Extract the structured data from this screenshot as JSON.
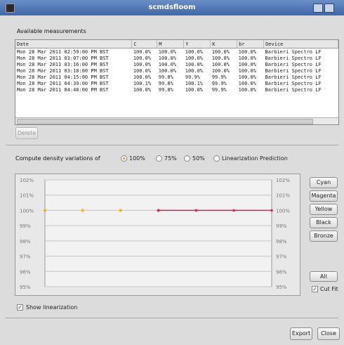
{
  "window": {
    "title": "scmdsfloom"
  },
  "measurements": {
    "section_label": "Available measurements",
    "columns": [
      "Date",
      "C",
      "M",
      "Y",
      "K",
      "br",
      "Device"
    ],
    "rows": [
      [
        "Mon 28 Mar 2011 02:59:00 PM BST",
        "100.0%",
        "100.0%",
        "100.0%",
        "100.0%",
        "100.0%",
        "Barbieri Spectro LF"
      ],
      [
        "Mon 28 Mar 2011 03:07:00 PM BST",
        "100.0%",
        "100.0%",
        "100.0%",
        "100.0%",
        "100.0%",
        "Barbieri Spectro LF"
      ],
      [
        "Mon 28 Mar 2011 03:16:00 PM BST",
        "100.0%",
        "100.0%",
        "100.0%",
        "100.0%",
        "100.0%",
        "Barbieri Spectro LF"
      ],
      [
        "Mon 28 Mar 2011 03:18:00 PM BST",
        "100.0%",
        "100.0%",
        "100.0%",
        "100.0%",
        "100.0%",
        "Barbieri Spectro LF"
      ],
      [
        "Mon 28 Mar 2011 04:15:00 PM BST",
        "100.0%",
        "99.8%",
        "99.9%",
        "99.9%",
        "100.0%",
        "Barbieri Spectro LF"
      ],
      [
        "Mon 28 Mar 2011 04:39:00 PM BST",
        "100.1%",
        "99.8%",
        "100.1%",
        "99.9%",
        "100.0%",
        "Barbieri Spectro LF"
      ],
      [
        "Mon 28 Mar 2011 04:48:00 PM BST",
        "100.0%",
        "99.8%",
        "100.0%",
        "99.9%",
        "100.0%",
        "Barbieri Spectro LF"
      ]
    ],
    "delete_label": "Delete"
  },
  "compute": {
    "label": "Compute density variations of",
    "options": [
      "100%",
      "75%",
      "50%",
      "Linearization Prediction"
    ],
    "selected": "100%"
  },
  "chart_data": {
    "type": "line",
    "y_tick_labels": [
      "102%",
      "101%",
      "100%",
      "99%",
      "98%",
      "97%",
      "96%",
      "95%"
    ],
    "ylim": [
      95,
      102
    ],
    "series": [
      {
        "color": "#f0b030",
        "values": [
          100.0,
          100.0,
          100.0,
          100.0,
          null,
          null,
          null
        ]
      },
      {
        "color": "#c8285a",
        "values": [
          null,
          null,
          null,
          100.0,
          100.0,
          100.0,
          100.0
        ]
      }
    ],
    "grid": true
  },
  "channels": [
    "Cyan",
    "Magenta",
    "Yellow",
    "Black",
    "Bronze"
  ],
  "toggles": {
    "all_label": "All",
    "cut_label": "Cut Fit",
    "cut_checked": true
  },
  "footer": {
    "show_label": "Show linearization",
    "show_checked": true,
    "export_label": "Export",
    "close_label": "Close"
  }
}
